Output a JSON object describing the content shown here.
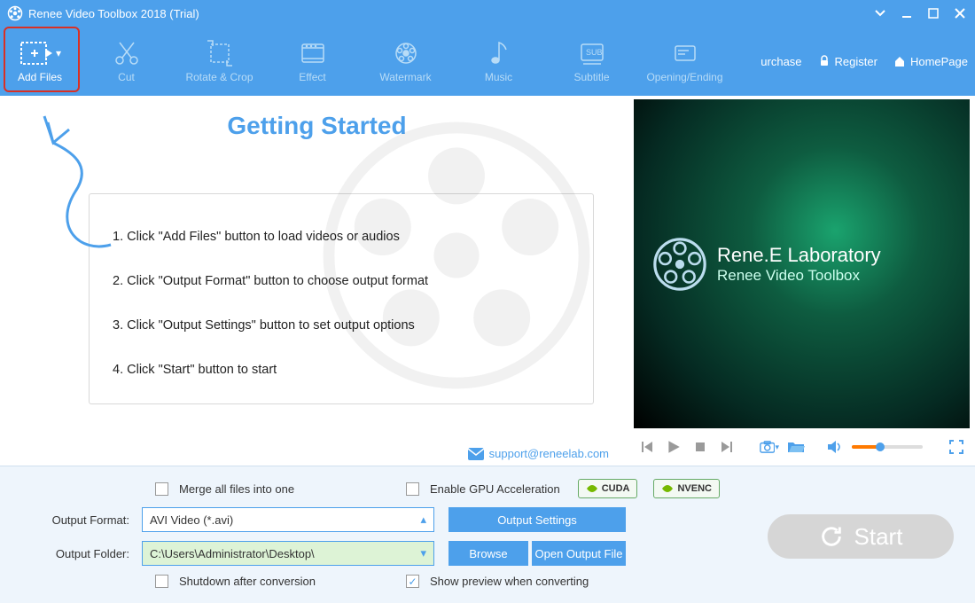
{
  "window": {
    "title": "Renee Video Toolbox 2018 (Trial)"
  },
  "toolbar": {
    "items": [
      {
        "name": "add-files",
        "label": "Add Files"
      },
      {
        "name": "cut",
        "label": "Cut"
      },
      {
        "name": "rotate-crop",
        "label": "Rotate & Crop"
      },
      {
        "name": "effect",
        "label": "Effect"
      },
      {
        "name": "watermark",
        "label": "Watermark"
      },
      {
        "name": "music",
        "label": "Music"
      },
      {
        "name": "subtitle",
        "label": "Subtitle"
      },
      {
        "name": "opening-ending",
        "label": "Opening/Ending"
      }
    ],
    "right": {
      "purchase": "urchase",
      "register": "Register",
      "homepage": "HomePage"
    }
  },
  "getting_started": {
    "heading": "Getting Started",
    "steps": [
      "1. Click \"Add Files\" button to load videos or audios",
      "2. Click \"Output Format\" button to choose output format",
      "3. Click \"Output Settings\" button to set output options",
      "4. Click \"Start\" button to start"
    ],
    "support_email": "support@reneelab.com"
  },
  "preview": {
    "brand_line1": "Rene.E Laboratory",
    "brand_line2": "Renee Video Toolbox"
  },
  "bottom": {
    "merge_label": "Merge all files into one",
    "merge_checked": false,
    "gpu_label": "Enable GPU Acceleration",
    "gpu_checked": false,
    "badges": [
      "CUDA",
      "NVENC"
    ],
    "output_format_label": "Output Format:",
    "output_format_value": "AVI Video (*.avi)",
    "output_settings_btn": "Output Settings",
    "output_folder_label": "Output Folder:",
    "output_folder_value": "C:\\Users\\Administrator\\Desktop\\",
    "browse_btn": "Browse",
    "open_folder_btn": "Open Output File",
    "shutdown_label": "Shutdown after conversion",
    "shutdown_checked": false,
    "show_preview_label": "Show preview when converting",
    "show_preview_checked": true,
    "start_btn": "Start"
  }
}
